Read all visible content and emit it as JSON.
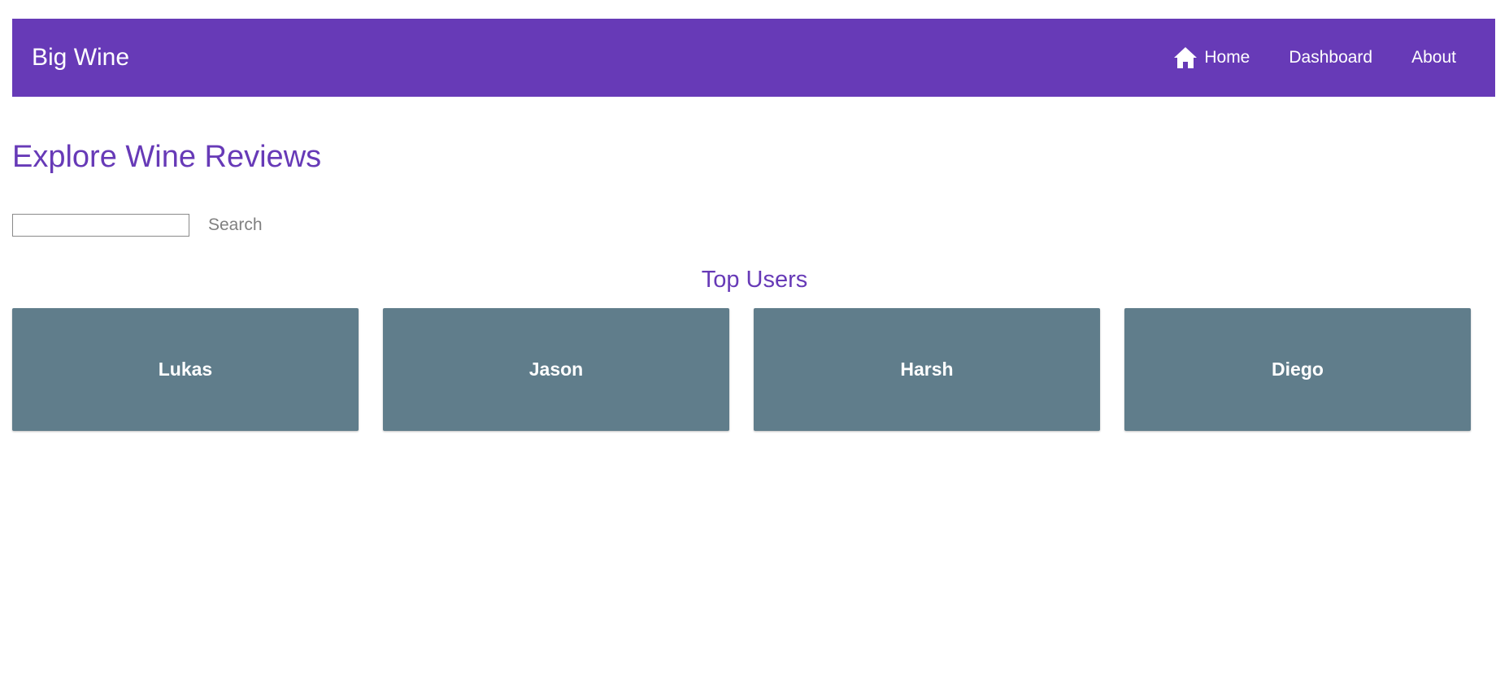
{
  "header": {
    "brand": "Big Wine",
    "nav": [
      {
        "label": "Home",
        "icon": "home-icon"
      },
      {
        "label": "Dashboard"
      },
      {
        "label": "About"
      }
    ]
  },
  "main": {
    "title": "Explore Wine Reviews",
    "search": {
      "value": "",
      "placeholder": "",
      "button_label": "Search"
    },
    "top_users": {
      "title": "Top Users",
      "users": [
        {
          "name": "Lukas"
        },
        {
          "name": "Jason"
        },
        {
          "name": "Harsh"
        },
        {
          "name": "Diego"
        }
      ]
    }
  },
  "colors": {
    "primary": "#673ab7",
    "card": "#607d8b",
    "muted": "#808080"
  }
}
